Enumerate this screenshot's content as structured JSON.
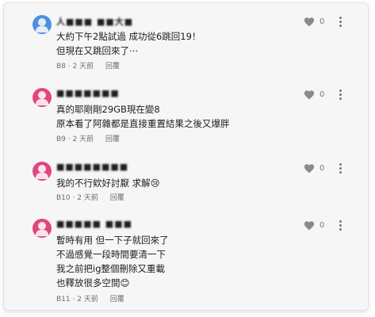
{
  "colors": {
    "avatar_blue": "#4d90e0",
    "avatar_pink": "#e0467f",
    "heart": "#8a8a8a"
  },
  "comments": [
    {
      "username": "人■■■ ■■大■",
      "avatar_color": "#4d90e0",
      "lines": [
        "大約下午2點試過 成功從6跳回19！",
        "但現在又跳回來了⋯"
      ],
      "floor": "B8",
      "time": "2 天前",
      "reply_label": "回覆",
      "likes": "0",
      "icons": {
        "like": "heart-icon",
        "more": "kebab-menu-icon"
      }
    },
    {
      "username": "■■■■■■■",
      "avatar_color": "#e0467f",
      "lines": [
        "真的耶剛剛29GB現在變8",
        "原本看了阿雜都是直接重置結果之後又爆胖"
      ],
      "floor": "B9",
      "time": "2 天前",
      "reply_label": "回覆",
      "likes": "0",
      "icons": {
        "like": "heart-icon",
        "more": "kebab-menu-icon"
      }
    },
    {
      "username": "■■■■■■■■",
      "avatar_color": "#e0467f",
      "lines": [
        "我的不行欸好討厭 求解😢"
      ],
      "floor": "B10",
      "time": "2 天前",
      "reply_label": "回覆",
      "likes": "0",
      "icons": {
        "like": "heart-icon",
        "more": "kebab-menu-icon"
      }
    },
    {
      "username": "■■■■■ ■■■",
      "avatar_color": "#e0467f",
      "lines": [
        "暫時有用 但一下子就回來了",
        "不過感覺一段時間要清一下",
        "我之前把ig整個刪除又重載",
        "也釋放很多空間😊"
      ],
      "floor": "B11",
      "time": "2 天前",
      "reply_label": "回覆",
      "likes": "0",
      "icons": {
        "like": "heart-icon",
        "more": "kebab-menu-icon"
      }
    }
  ]
}
